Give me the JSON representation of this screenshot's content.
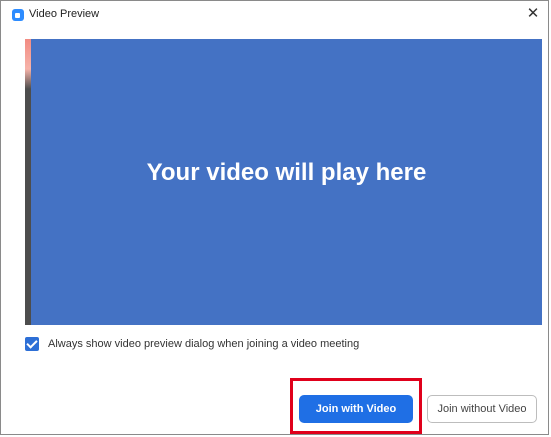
{
  "window": {
    "title": "Video Preview",
    "close_glyph": "✕"
  },
  "video": {
    "placeholder_text": "Your video will play here",
    "background_color": "#4472c4"
  },
  "options": {
    "always_show_preview_label": "Always show video preview dialog when joining a video meeting",
    "always_show_preview_checked": true
  },
  "buttons": {
    "join_with_video": "Join with Video",
    "join_without_video": "Join without Video"
  },
  "colors": {
    "accent": "#1f6fe5",
    "highlight": "#e0001b"
  },
  "icons": {
    "app": "zoom-app-icon",
    "close": "close-icon"
  }
}
